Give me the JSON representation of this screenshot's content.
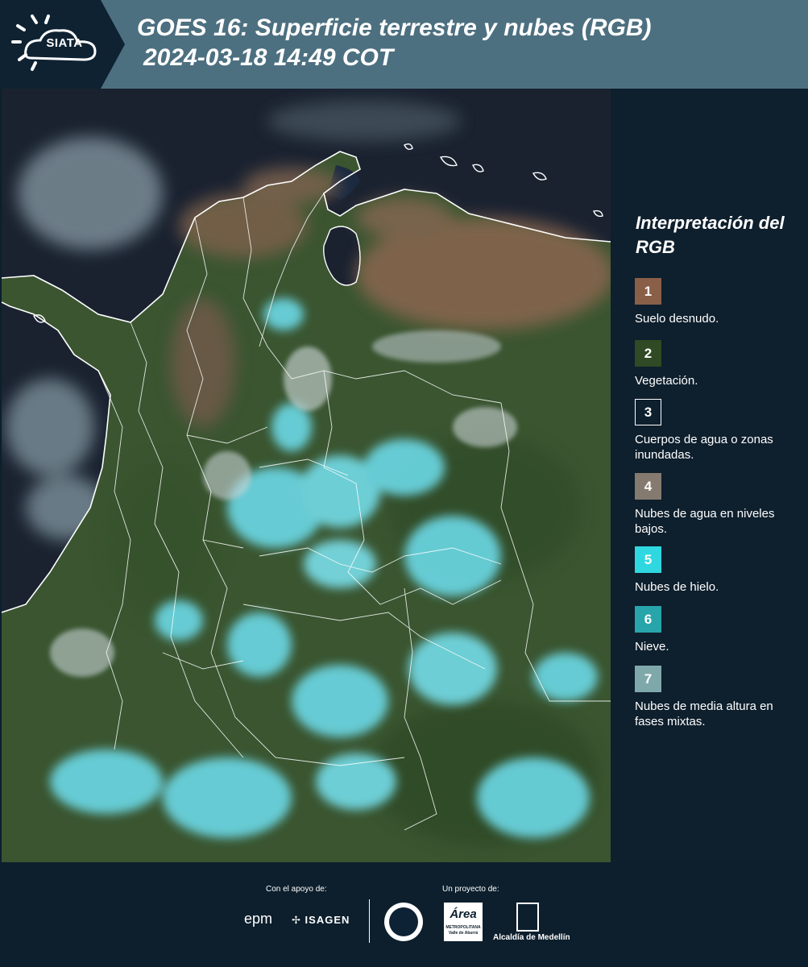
{
  "header": {
    "logo_text": "SIATA",
    "title": "GOES 16: Superficie terrestre y nubes (RGB)",
    "subtitle": "2024-03-18 14:49 COT",
    "background": "#4d7080"
  },
  "map": {
    "description_colors": {
      "ocean": "#1b2533",
      "vegetation": "#3c5a32",
      "bare_soil": "#7a5f48",
      "ice_cloud": "#67d8e6",
      "low_cloud": "#c9d3d6",
      "borders": "#ffffff"
    }
  },
  "legend": {
    "title": "Interpretación del RGB",
    "items": [
      {
        "number": "1",
        "label": "Suelo desnudo.",
        "color": "#8a5f48"
      },
      {
        "number": "2",
        "label": "Vegetación.",
        "color": "#2f4a24"
      },
      {
        "number": "3",
        "label": "Cuerpos de agua o zonas inundadas.",
        "color": "#0e1f2d"
      },
      {
        "number": "4",
        "label": "Nubes de agua en niveles bajos.",
        "color": "#857a6f"
      },
      {
        "number": "5",
        "label": "Nubes de hielo.",
        "color": "#2fd8e0"
      },
      {
        "number": "6",
        "label": "Nieve.",
        "color": "#27a5aa"
      },
      {
        "number": "7",
        "label": "Nubes de media altura en fases mixtas.",
        "color": "#7fa8ab"
      }
    ]
  },
  "footer": {
    "support_label": "Con el apoyo de:",
    "project_label": "Un proyecto de:",
    "sponsor_epm": "epm",
    "sponsor_isagen": "ISAGEN",
    "area_logo": "Área",
    "area_sub": "METROPOLITANA Valle de Aburrá",
    "alcaldia": "Alcaldía de Medellín"
  }
}
